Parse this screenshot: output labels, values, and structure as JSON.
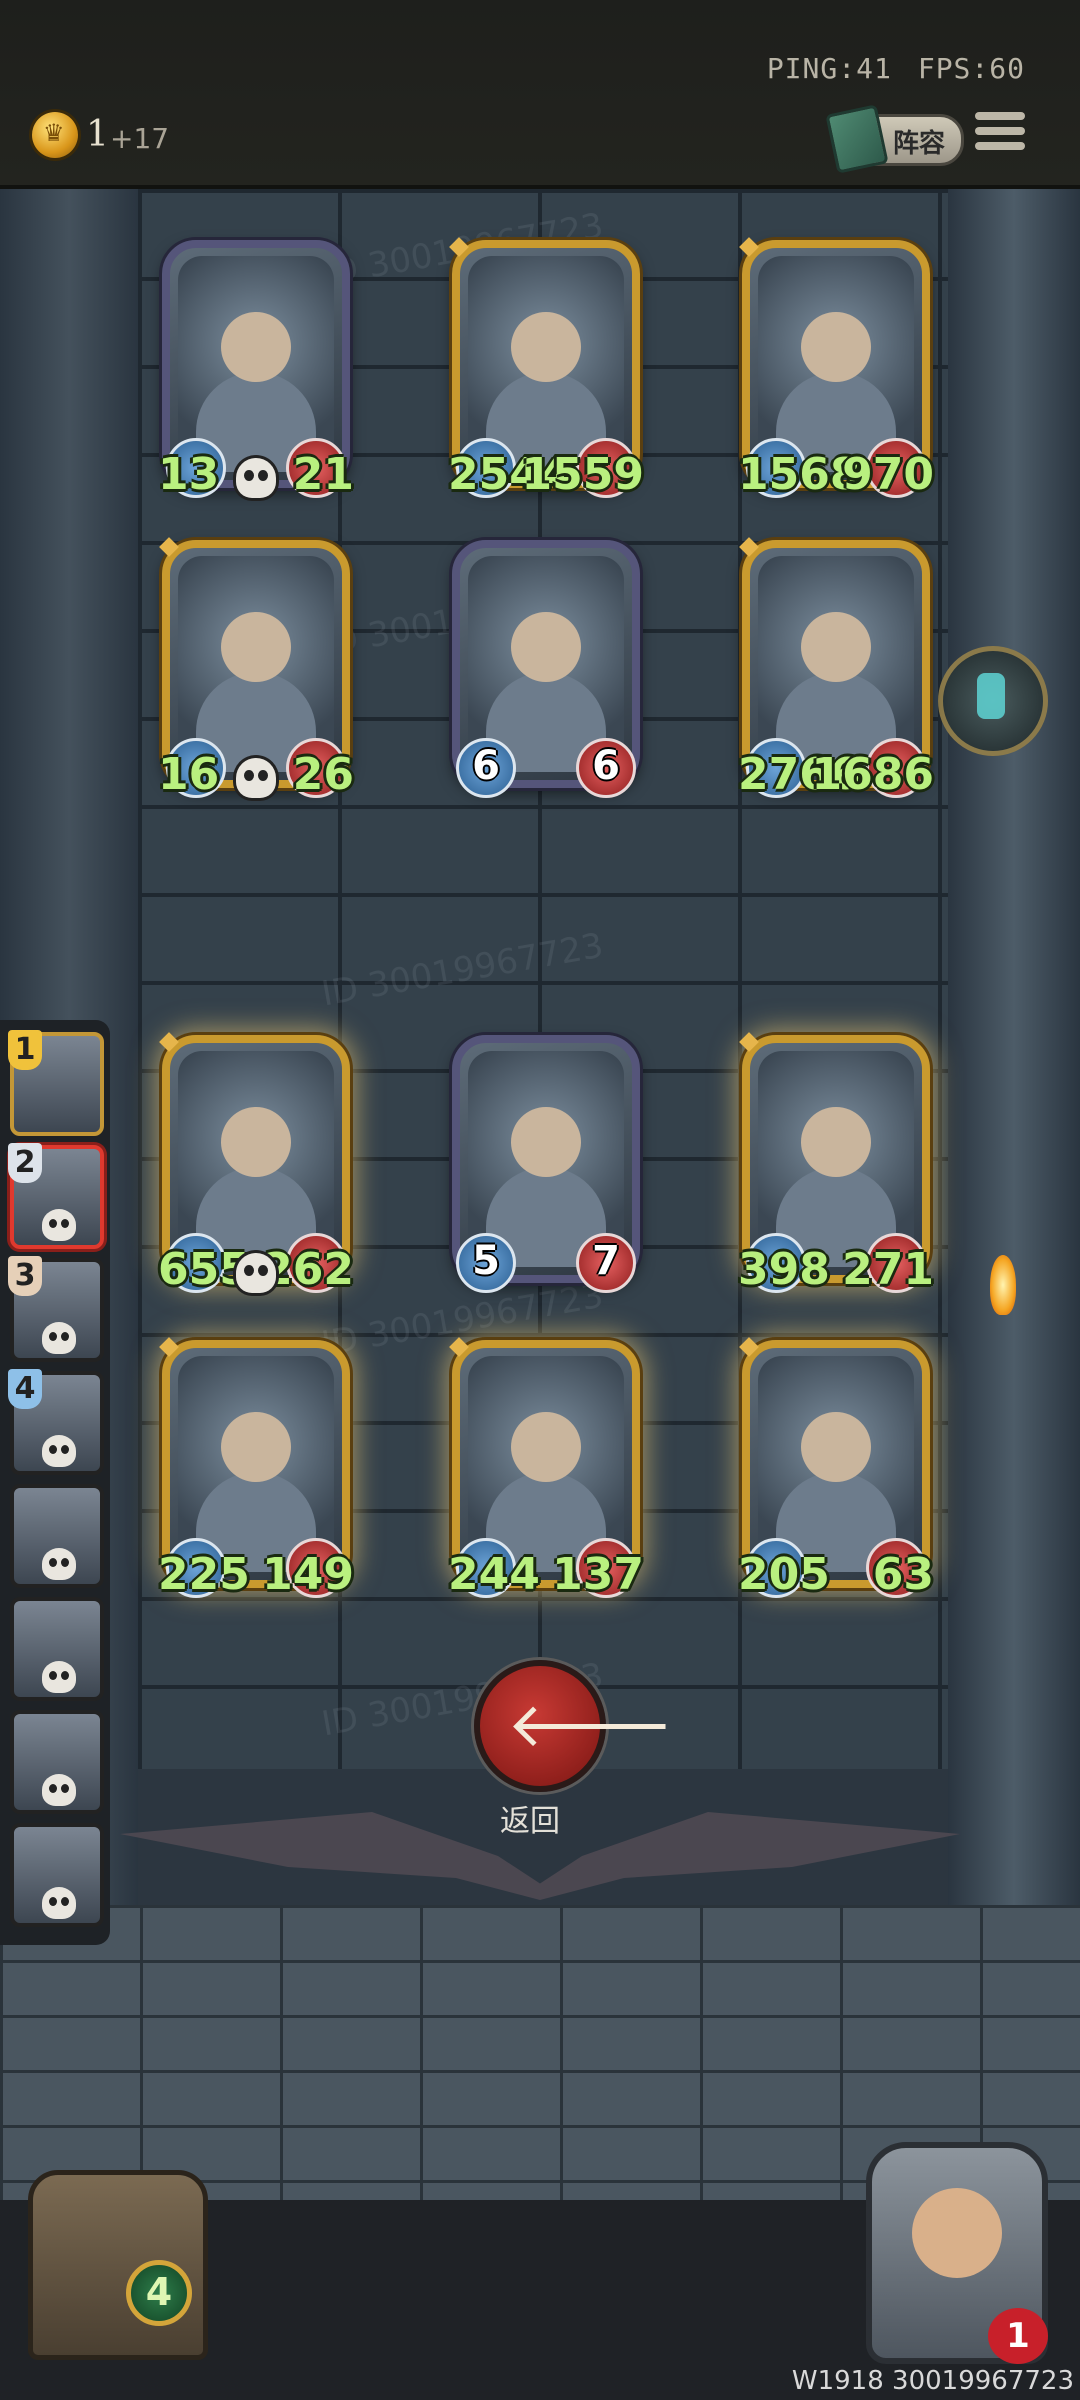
{
  "status": {
    "ping": "PING:41",
    "fps": "FPS:60"
  },
  "currency": {
    "amount": "1",
    "income": "+17"
  },
  "lineup_button": "阵容",
  "watermark": "ID 30019967723",
  "board": [
    {
      "atk": "13",
      "hp": "21",
      "frame": "purple"
    },
    {
      "atk": "2544",
      "hp": "1559",
      "frame": "gold"
    },
    {
      "atk": "1568",
      "hp": "970",
      "frame": "gold"
    },
    {
      "atk": "16",
      "hp": "26",
      "frame": "gold"
    },
    {
      "atk": "6",
      "hp": "6",
      "frame": "purple"
    },
    {
      "atk": "2766",
      "hp": "1686",
      "frame": "gold"
    },
    {
      "atk": "655",
      "hp": "262",
      "frame": "gold"
    },
    {
      "atk": "5",
      "hp": "7",
      "frame": "purple"
    },
    {
      "atk": "398",
      "hp": "271",
      "frame": "gold"
    },
    {
      "atk": "225",
      "hp": "149",
      "frame": "gold"
    },
    {
      "atk": "244",
      "hp": "137",
      "frame": "gold"
    },
    {
      "atk": "205",
      "hp": "63",
      "frame": "gold"
    }
  ],
  "opponents": [
    {
      "rank": "1"
    },
    {
      "rank": "2"
    },
    {
      "rank": "3"
    },
    {
      "rank": "4"
    },
    {
      "rank": ""
    },
    {
      "rank": ""
    },
    {
      "rank": ""
    },
    {
      "rank": ""
    }
  ],
  "back_button": "返回",
  "chest_count": "4",
  "player_lives": "1",
  "footer_id": "W1918 30019967723",
  "colors": {
    "stat_text": "#b9f07f",
    "gold_frame": "#c99a2e",
    "purple_frame": "#55557a",
    "back_button": "#c83a34"
  }
}
